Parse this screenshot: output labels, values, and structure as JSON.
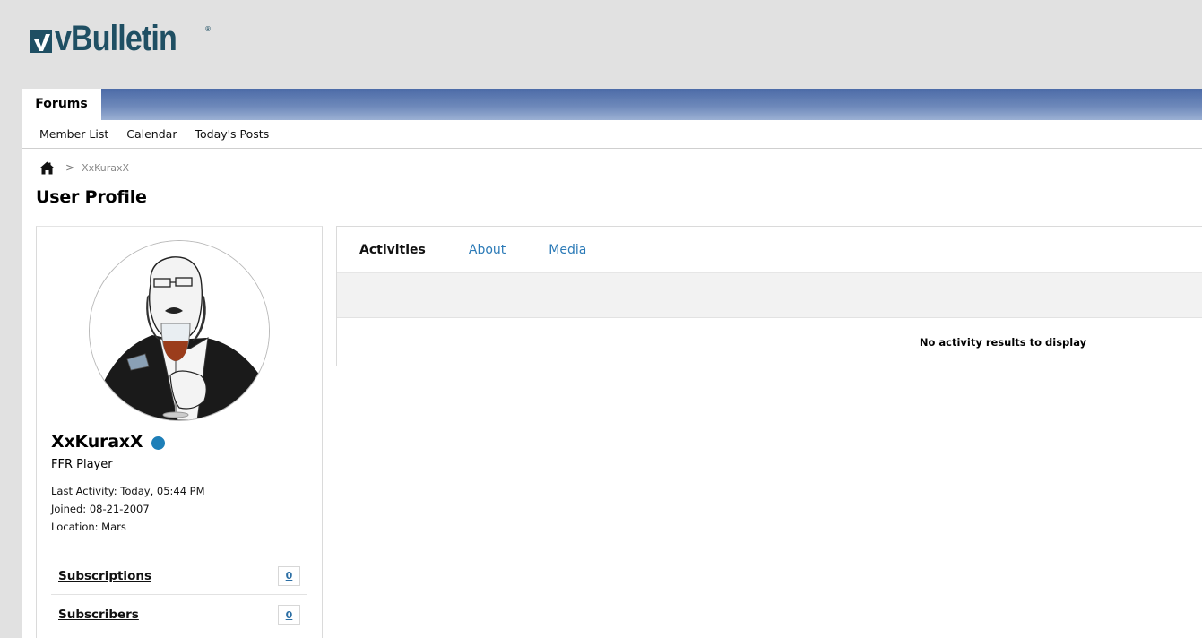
{
  "brand": {
    "logo_text": "vBulletin",
    "logo_reg": "®",
    "color": "#1f4f63"
  },
  "tabbar": {
    "forums_label": "Forums"
  },
  "subnav": {
    "items": [
      "Member List",
      "Calendar",
      "Today's Posts"
    ]
  },
  "breadcrumb": {
    "current": "XxKuraxX",
    "separator": ">"
  },
  "page": {
    "title": "User Profile"
  },
  "profile": {
    "username": "XxKuraxX",
    "online_color": "#1e7fb8",
    "user_title": "FFR Player",
    "last_activity": "Last Activity: Today, 05:44 PM",
    "joined": "Joined: 08-21-2007",
    "location": "Location: Mars",
    "stats": [
      {
        "label": "Subscriptions",
        "count": "0"
      },
      {
        "label": "Subscribers",
        "count": "0"
      }
    ]
  },
  "activity": {
    "tabs": [
      "Activities",
      "About",
      "Media"
    ],
    "active_tab": "Activities",
    "empty_message": "No activity results to display"
  },
  "icons": {
    "home": "home-icon",
    "status": "online-status-icon"
  }
}
